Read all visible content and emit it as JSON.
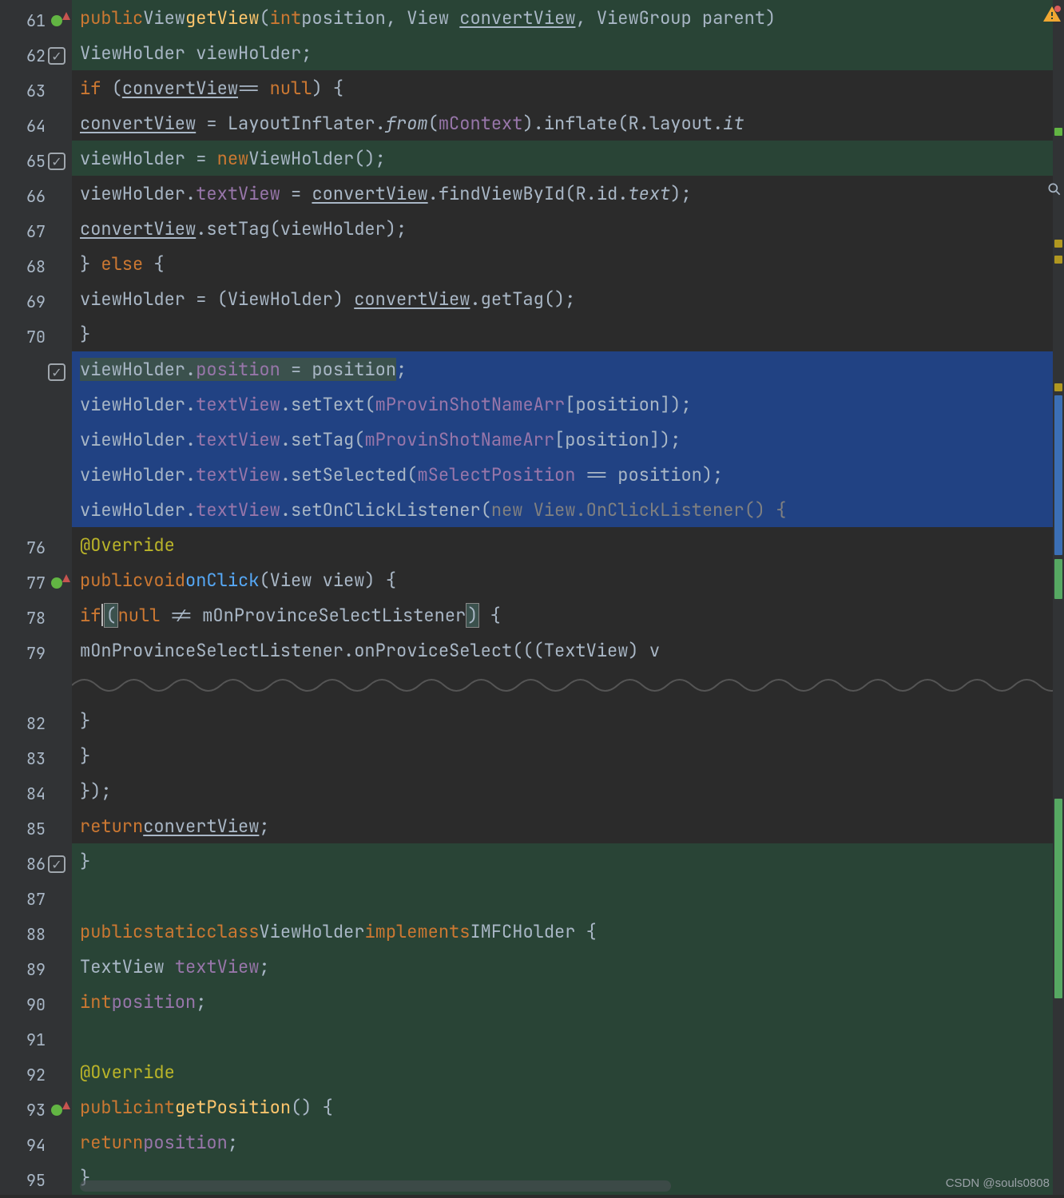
{
  "watermark": "CSDN @souls0808",
  "gutter": {
    "lines": [
      {
        "n": "61",
        "mark": "circle"
      },
      {
        "n": "62",
        "mark": "check"
      },
      {
        "n": "63"
      },
      {
        "n": "64"
      },
      {
        "n": "65",
        "mark": "check"
      },
      {
        "n": "66"
      },
      {
        "n": "67"
      },
      {
        "n": "68"
      },
      {
        "n": "69"
      },
      {
        "n": "70"
      },
      {
        "n": "",
        "mark": "check",
        "dim": true
      },
      {
        "n": "",
        "dim": true
      },
      {
        "n": "",
        "dim": true
      },
      {
        "n": "",
        "dim": true
      },
      {
        "n": "",
        "dim": true
      },
      {
        "n": "76"
      },
      {
        "n": "77",
        "mark": "circle"
      },
      {
        "n": "78"
      },
      {
        "n": "79"
      },
      {
        "n": "fold"
      },
      {
        "n": "82"
      },
      {
        "n": "83"
      },
      {
        "n": "84"
      },
      {
        "n": "85"
      },
      {
        "n": "86",
        "mark": "check"
      },
      {
        "n": "87"
      },
      {
        "n": "88"
      },
      {
        "n": "89"
      },
      {
        "n": "90"
      },
      {
        "n": "91"
      },
      {
        "n": "92"
      },
      {
        "n": "93",
        "mark": "circle"
      },
      {
        "n": "94"
      },
      {
        "n": "95"
      }
    ]
  },
  "tokens": {
    "public": "public",
    "View": "View",
    "getView": "getView",
    "int": "int",
    "position": "position",
    "position_f": "position",
    "View2": "View",
    "convertView": "convertView",
    "ViewGroup": "ViewGroup",
    "parent": "parent",
    "ViewHolder": "ViewHolder",
    "viewHolder": "viewHolder",
    "if": "if",
    "eqeq": "==",
    "null": "null",
    "LayoutInflater": "LayoutInflater",
    "from": "from",
    "mContext": "mContext",
    "inflate": "inflate",
    "R": "R",
    "layout": "layout",
    "it": "it",
    "new": "new",
    "textView": "textView",
    "findViewById": "findViewById",
    "id": "id",
    "text": "text",
    "setTag": "setTag",
    "else": "else",
    "getTag": "getTag",
    "setText": "setText",
    "mProvinShotNameArr": "mProvinShotNameArr",
    "setSelected": "setSelected",
    "mSelectPosition": "mSelectPosition",
    "setOnClickListener": "setOnClickListener",
    "OnClickListener": "OnClickListener",
    "Override": "@Override",
    "void": "void",
    "onClick": "onClick",
    "view": "view",
    "neq": "!=",
    "mOnProvinceSelectListener": "mOnProvinceSelectListener",
    "onProviceSelect": "onProviceSelect",
    "TextView": "TextView",
    "return": "return",
    "static": "static",
    "class": "class",
    "implements": "implements",
    "IMFCHolder": "IMFCHolder",
    "getPosition": "getPosition",
    "v": "v"
  }
}
